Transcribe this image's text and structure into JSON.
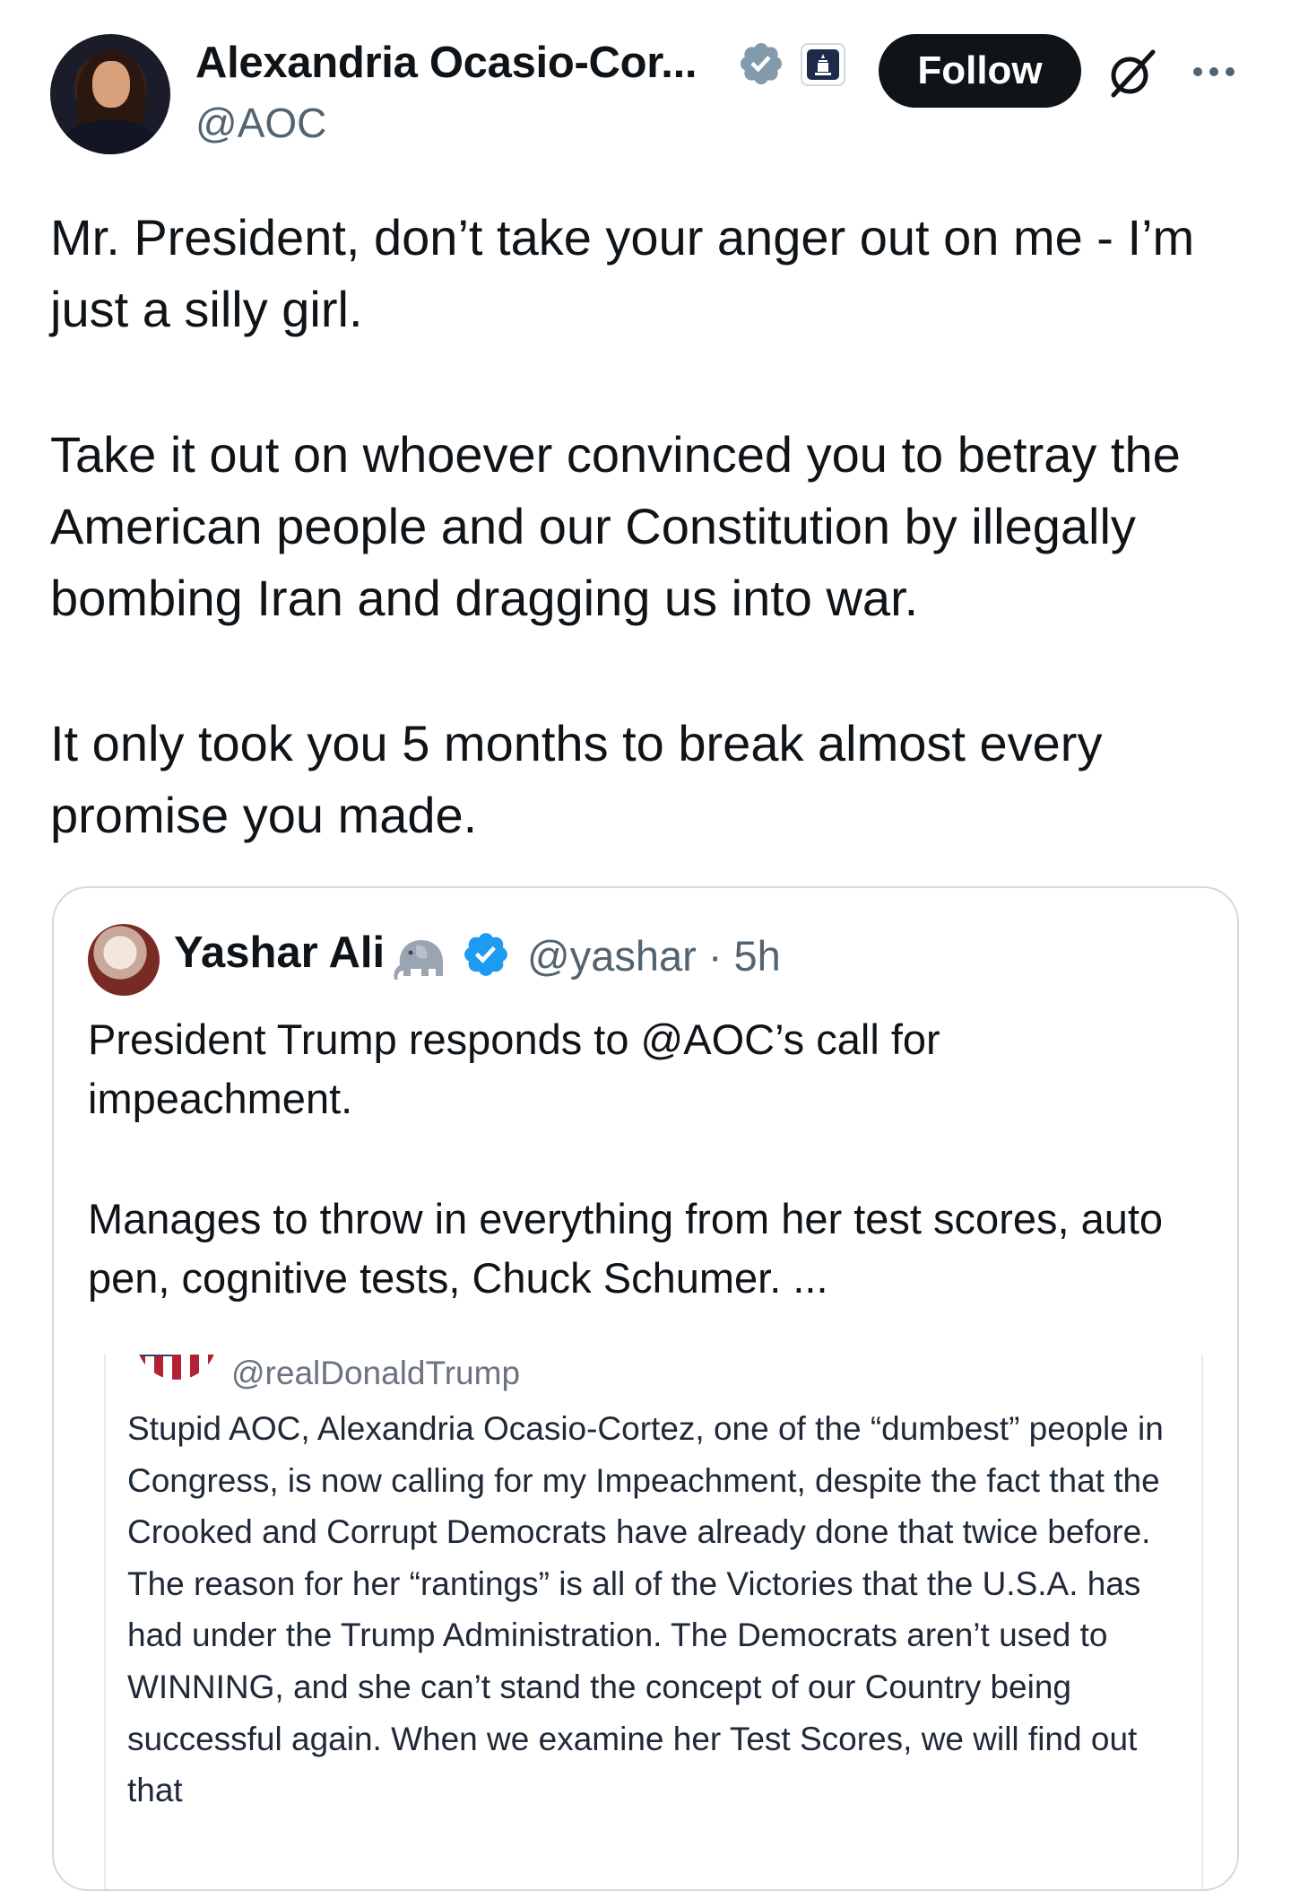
{
  "author": {
    "display_name": "Alexandria Ocasio-Cor...",
    "handle": "@AOC"
  },
  "header": {
    "follow_label": "Follow"
  },
  "tweet": {
    "paragraphs": [
      "Mr. President, don’t take your anger out on me - I’m just a silly girl.",
      "Take it out on whoever convinced you to betray the American people and our Constitution by illegally bombing Iran and dragging us into war.",
      "It only took you 5 months to break almost every promise you made."
    ]
  },
  "quote": {
    "name": "Yashar Ali",
    "emoji": "🐘",
    "meta": "@yashar · 5h",
    "paragraphs": [
      "President Trump responds to @AOC’s call for impeachment.",
      "Manages to throw in everything from her test scores, auto pen, cognitive tests, Chuck Schumer. ..."
    ],
    "embedded_post": {
      "handle": "@realDonaldTrump",
      "text": "Stupid AOC, Alexandria Ocasio-Cortez, one of the “dumbest” people in Congress, is now calling for my Impeachment, despite the fact that the Crooked and Corrupt Democrats have already done that twice before. The reason for her “rantings” is all of the Victories that the U.S.A. has had under the Trump Administration. The Democrats aren’t used to WINNING, and she can’t stand the concept of our Country being successful again. When we examine her Test Scores, we will find out that"
    }
  },
  "colors": {
    "text": "#0f1419",
    "secondary": "#536471",
    "verified_blue": "#1d9bf0",
    "verified_grey": "#829aab",
    "border": "#cfd9de"
  },
  "icons": {
    "verified_grey": "verified-grey-badge-icon",
    "gov_badge": "capitol-affiliate-badge-icon",
    "grok": "grok-slash-icon",
    "more": "more-horizontal-icon",
    "verified_blue": "verified-blue-badge-icon",
    "emoji": "elephant-emoji-icon"
  }
}
